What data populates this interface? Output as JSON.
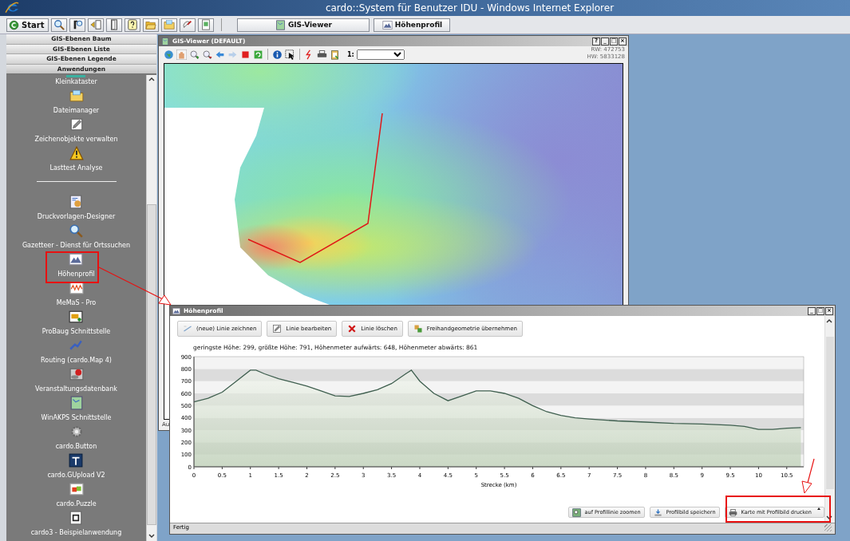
{
  "window": {
    "title": "cardo::System für Benutzer IDU - Windows Internet Explorer"
  },
  "toolbar": {
    "start": "Start",
    "tasks": [
      {
        "label": "GIS-Viewer"
      },
      {
        "label": "Höhenprofil"
      }
    ]
  },
  "sidebar": {
    "sections": [
      {
        "label": "GIS-Ebenen Baum",
        "expanded": false
      },
      {
        "label": "GIS-Ebenen Liste",
        "expanded": false
      },
      {
        "label": "GIS-Ebenen Legende",
        "expanded": false
      },
      {
        "label": "Anwendungen",
        "expanded": true
      }
    ],
    "items": [
      {
        "kind": "app",
        "label": "Kleinkataster"
      },
      {
        "kind": "app",
        "label": "Dateimanager"
      },
      {
        "kind": "app",
        "label": "Zeichenobjekte verwalten"
      },
      {
        "kind": "app",
        "label": "Lasttest Analyse"
      },
      {
        "kind": "separator"
      },
      {
        "kind": "app",
        "label": "Druckvorlagen-Designer"
      },
      {
        "kind": "app",
        "label": "Gazetteer - Dienst für Ortssuchen"
      },
      {
        "kind": "app",
        "label": "Höhenprofil"
      },
      {
        "kind": "app",
        "label": "MeMaS - Pro"
      },
      {
        "kind": "app",
        "label": "ProBaug Schnittstelle"
      },
      {
        "kind": "app",
        "label": "Routing (cardo.Map 4)"
      },
      {
        "kind": "app",
        "label": "Veranstaltungsdatenbank"
      },
      {
        "kind": "app",
        "label": "WinAKPS Schnittstelle"
      },
      {
        "kind": "app",
        "label": "cardo.Button"
      },
      {
        "kind": "app",
        "label": "cardo.GUpload V2"
      },
      {
        "kind": "app",
        "label": "cardo.Puzzle"
      },
      {
        "kind": "app",
        "label": "cardo3 - Beispielanwendung"
      }
    ]
  },
  "gis_viewer": {
    "title": "GIS-Viewer (DEFAULT)",
    "window_buttons": [
      "?",
      "_",
      "□",
      "×"
    ],
    "scale_label": "1:",
    "rw": "RW: 472753",
    "hw": "HW: 5833128",
    "status": "Au"
  },
  "profile_window": {
    "title": "Höhenprofil",
    "window_buttons": [
      "_",
      "□",
      "×"
    ],
    "actions": [
      {
        "label": "(neue) Linie zeichnen"
      },
      {
        "label": "Linie bearbeiten"
      },
      {
        "label": "Linie löschen"
      },
      {
        "label": "Freihandgeometrie übernehmen"
      }
    ],
    "summary": "geringste Höhe: 299, größte Höhe: 791, Höhenmeter aufwärts: 648, Höhenmeter abwärts: 861",
    "chart_data": {
      "type": "area",
      "xlabel": "Strecke (km)",
      "xlim": [
        0,
        10.8
      ],
      "ylim": [
        0,
        900
      ],
      "xticks": [
        0,
        0.5,
        1,
        1.5,
        2,
        2.5,
        3,
        3.5,
        4,
        4.5,
        5,
        5.5,
        6,
        6.5,
        7,
        7.5,
        8,
        8.5,
        9,
        9.5,
        10,
        10.5
      ],
      "yticks": [
        0,
        100,
        200,
        300,
        400,
        500,
        600,
        700,
        800,
        900
      ],
      "x": [
        0,
        0.25,
        0.5,
        0.75,
        1,
        1.1,
        1.25,
        1.5,
        1.75,
        2,
        2.25,
        2.5,
        2.75,
        3,
        3.25,
        3.5,
        3.75,
        3.85,
        4,
        4.25,
        4.5,
        4.75,
        5,
        5.25,
        5.5,
        5.75,
        6,
        6.25,
        6.5,
        6.75,
        7,
        7.5,
        8,
        8.5,
        9,
        9.5,
        9.75,
        10,
        10.25,
        10.5,
        10.75
      ],
      "series": [
        {
          "color": "#3f5f4f",
          "values": [
            530,
            560,
            610,
            700,
            790,
            790,
            760,
            720,
            690,
            660,
            620,
            580,
            575,
            600,
            630,
            680,
            760,
            790,
            700,
            600,
            540,
            580,
            620,
            620,
            600,
            560,
            500,
            450,
            420,
            400,
            390,
            375,
            365,
            355,
            350,
            340,
            330,
            305,
            305,
            315,
            320
          ]
        }
      ]
    },
    "bottom_actions": [
      {
        "label": "auf Profillinie zoomen",
        "menu": false
      },
      {
        "label": "Profilbild speichern",
        "menu": false
      },
      {
        "label": "Karte mit Profilbild drucken",
        "menu": true
      }
    ],
    "status": "Fertig"
  }
}
